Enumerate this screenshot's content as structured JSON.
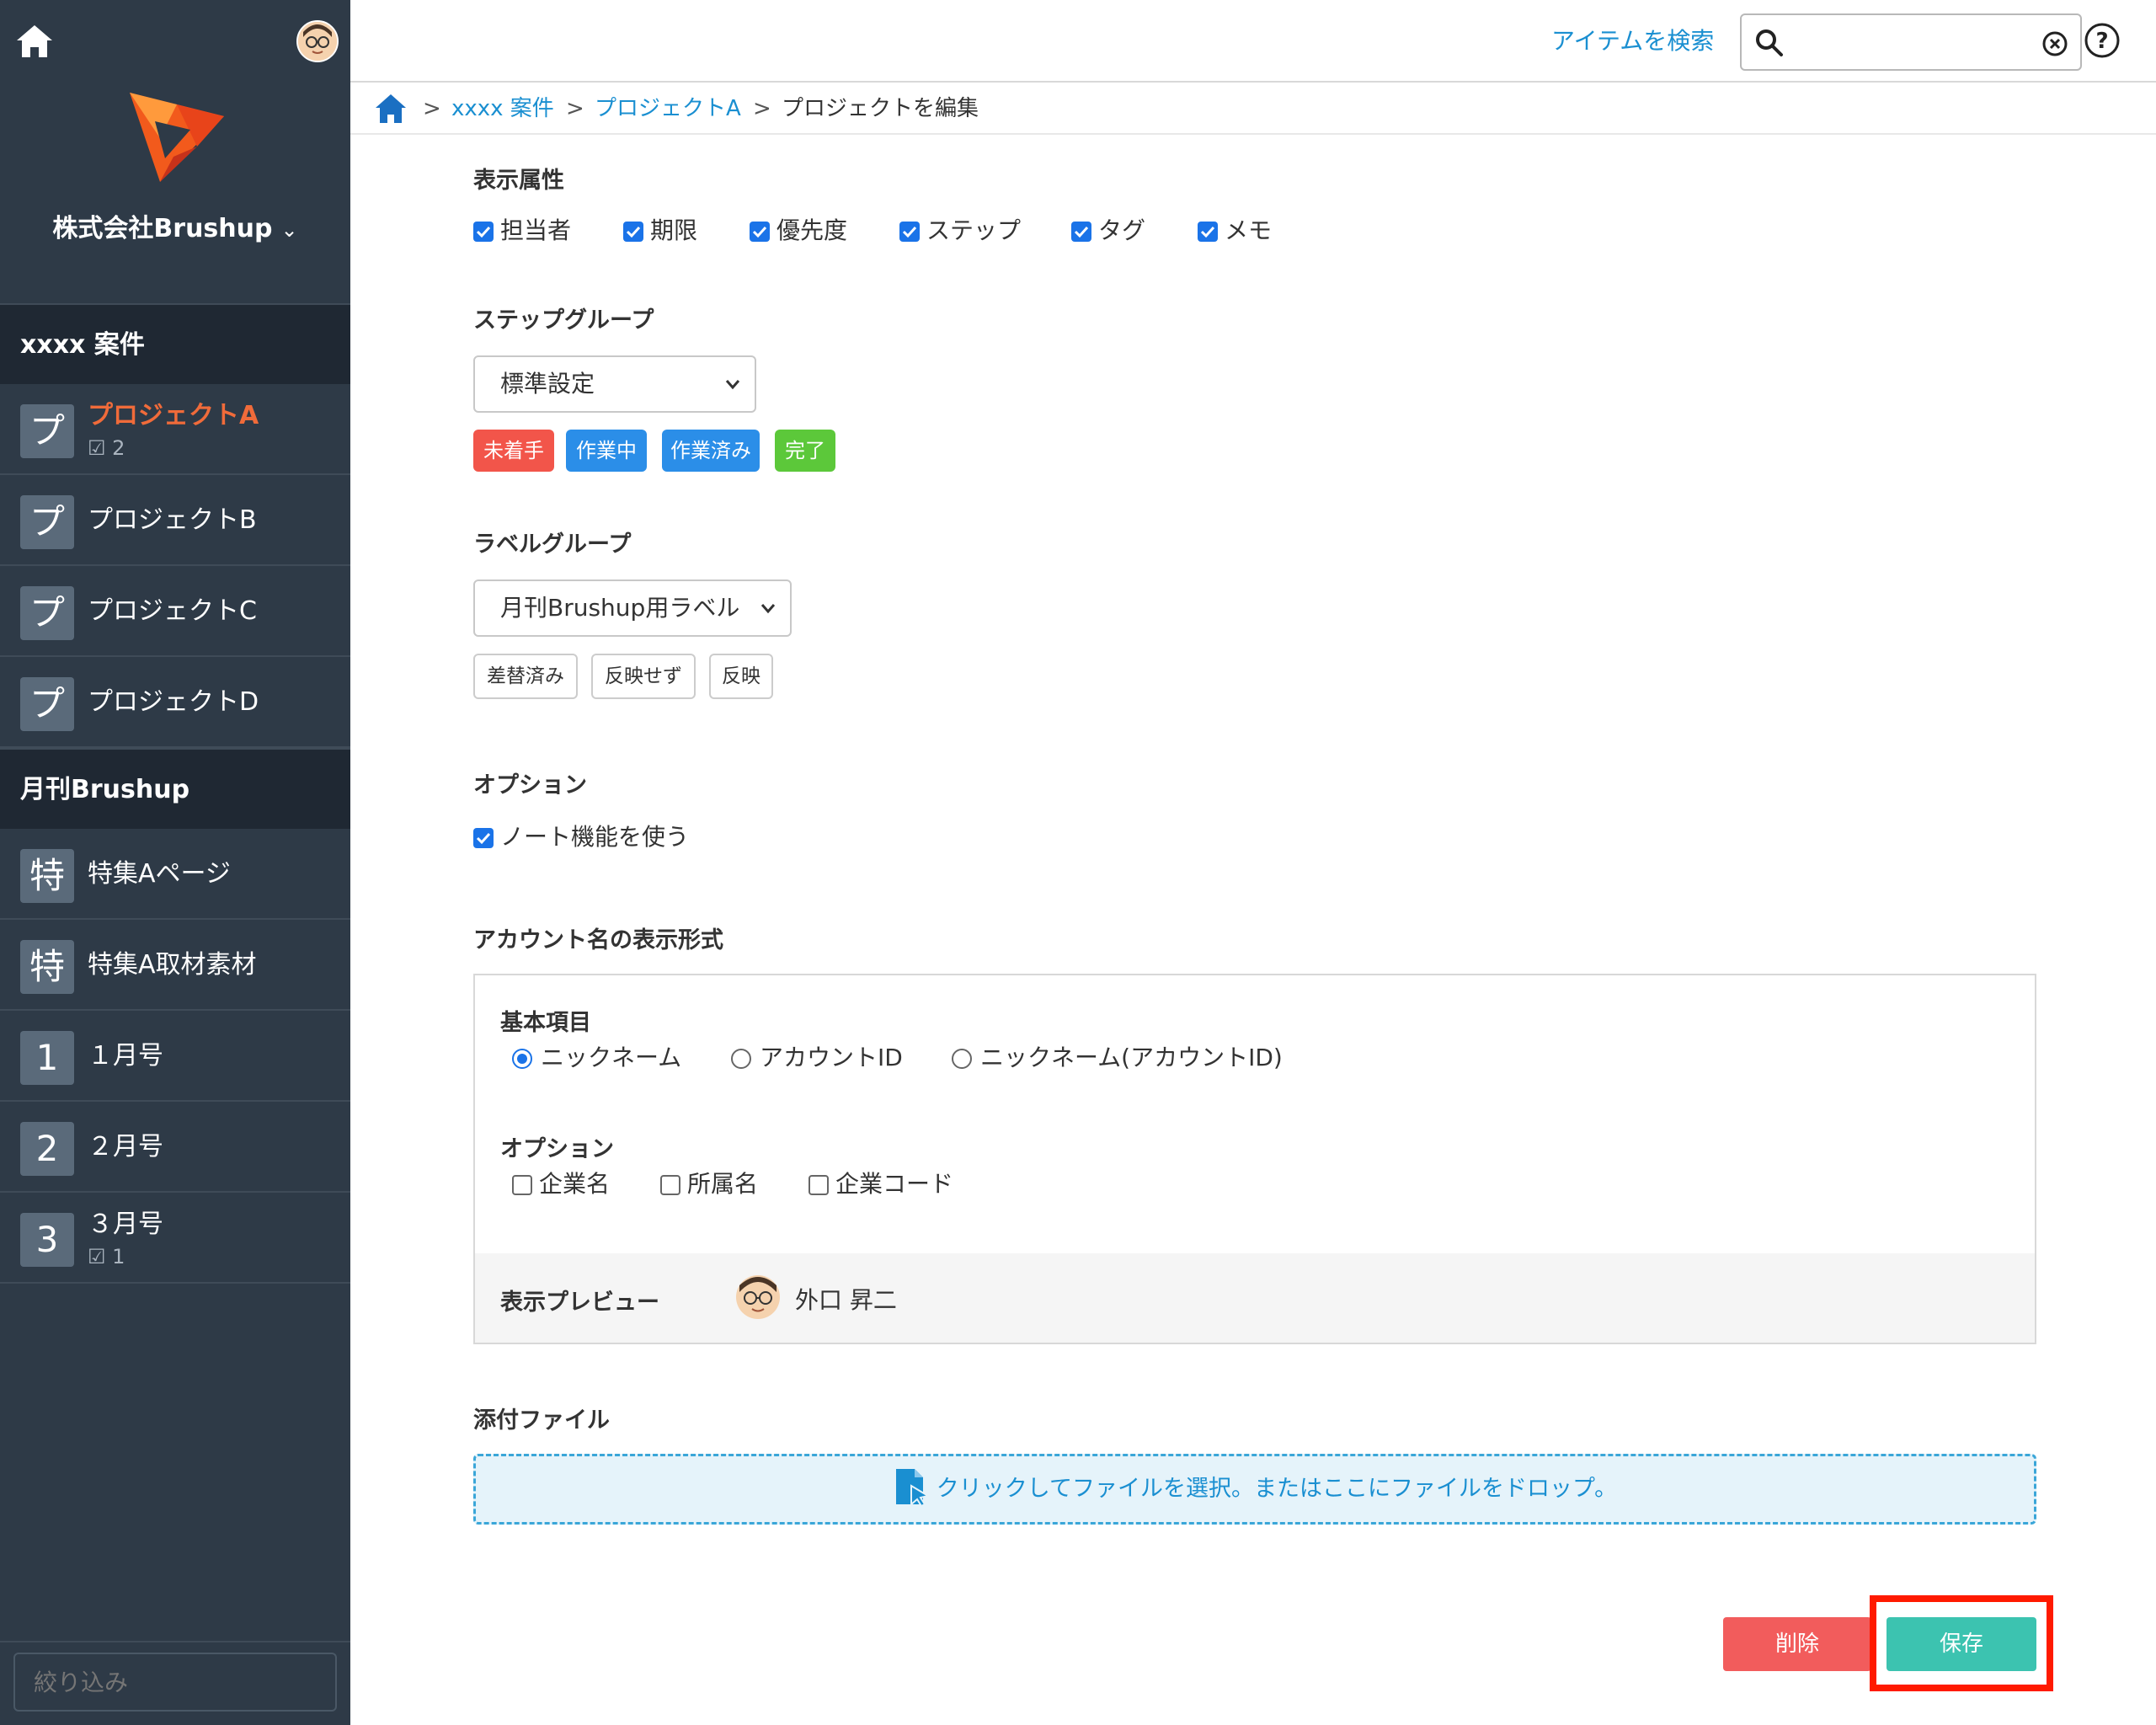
{
  "sidebar": {
    "company": "株式会社Brushup",
    "sections": [
      {
        "title": "xxxx 案件",
        "items": [
          {
            "icon": "プ",
            "label": "プロジェクトA",
            "count": "2",
            "active": true
          },
          {
            "icon": "プ",
            "label": "プロジェクトB"
          },
          {
            "icon": "プ",
            "label": "プロジェクトC"
          },
          {
            "icon": "プ",
            "label": "プロジェクトD"
          }
        ]
      },
      {
        "title": "月刊Brushup",
        "items": [
          {
            "icon": "特",
            "label": "特集Aページ"
          },
          {
            "icon": "特",
            "label": "特集A取材素材"
          },
          {
            "icon": "1",
            "label": "１月号"
          },
          {
            "icon": "2",
            "label": "２月号"
          },
          {
            "icon": "3",
            "label": "３月号",
            "count": "1"
          }
        ]
      }
    ],
    "filter_placeholder": "絞り込み"
  },
  "header": {
    "search_link": "アイテムを検索",
    "search_value": ""
  },
  "breadcrumb": {
    "items": [
      "xxxx 案件",
      "プロジェクトA",
      "プロジェクトを編集"
    ],
    "separator": ">"
  },
  "form": {
    "display_attributes": {
      "label": "表示属性",
      "options": [
        {
          "label": "担当者",
          "checked": true
        },
        {
          "label": "期限",
          "checked": true
        },
        {
          "label": "優先度",
          "checked": true
        },
        {
          "label": "ステップ",
          "checked": true
        },
        {
          "label": "タグ",
          "checked": true
        },
        {
          "label": "メモ",
          "checked": true
        }
      ]
    },
    "step_group": {
      "label": "ステップグループ",
      "selected": "標準設定",
      "steps": [
        {
          "label": "未着手",
          "color": "#f2554a"
        },
        {
          "label": "作業中",
          "color": "#2b8ee8"
        },
        {
          "label": "作業済み",
          "color": "#2b8ee8"
        },
        {
          "label": "完了",
          "color": "#5cc83a"
        }
      ]
    },
    "label_group": {
      "label": "ラベルグループ",
      "selected": "月刊Brushup用ラベル",
      "labels": [
        "差替済み",
        "反映せず",
        "反映"
      ]
    },
    "options": {
      "label": "オプション",
      "note_feature": {
        "label": "ノート機能を使う",
        "checked": true
      }
    },
    "account_format": {
      "label": "アカウント名の表示形式",
      "basic_label": "基本項目",
      "basic_options": [
        {
          "label": "ニックネーム",
          "selected": true
        },
        {
          "label": "アカウントID",
          "selected": false
        },
        {
          "label": "ニックネーム(アカウントID)",
          "selected": false
        }
      ],
      "option_label": "オプション",
      "option_items": [
        {
          "label": "企業名",
          "checked": false
        },
        {
          "label": "所属名",
          "checked": false
        },
        {
          "label": "企業コード",
          "checked": false
        }
      ],
      "preview_label": "表示プレビュー",
      "preview_name": "外口 昇二"
    },
    "attachments": {
      "label": "添付ファイル",
      "drop_text": "クリックしてファイルを選択。またはここにファイルをドロップ。"
    }
  },
  "buttons": {
    "delete": "削除",
    "save": "保存"
  },
  "colors": {
    "accent": "#1a8fd1",
    "active_project": "#f06b3a",
    "delete": "#f25c5c",
    "save": "#3cc3b0",
    "highlight": "#ff1a00"
  }
}
